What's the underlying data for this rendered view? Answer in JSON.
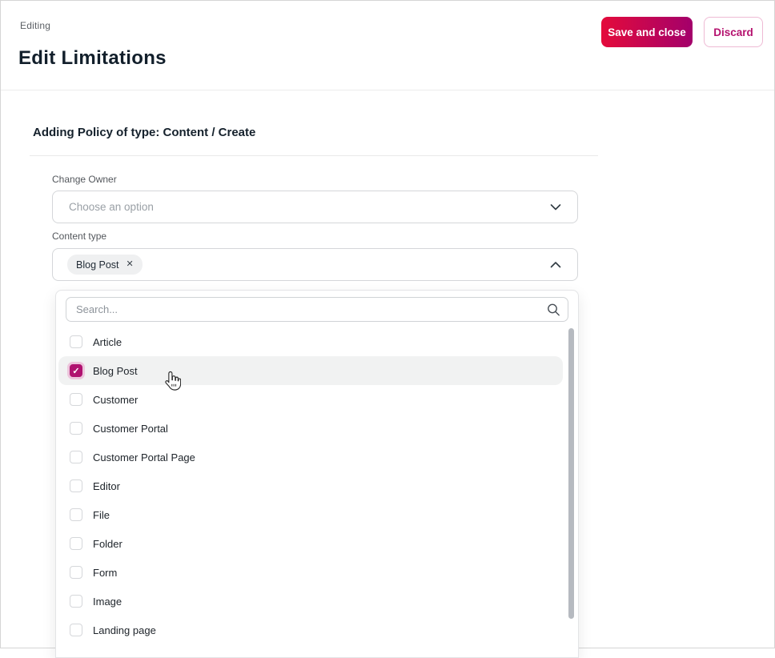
{
  "header": {
    "breadcrumb": "Editing",
    "title": "Edit Limitations",
    "save_label": "Save and close",
    "discard_label": "Discard"
  },
  "form": {
    "section_title": "Adding Policy of type: Content / Create",
    "change_owner": {
      "label": "Change Owner",
      "placeholder": "Choose an option"
    },
    "content_type": {
      "label": "Content type",
      "chip_label": "Blog Post",
      "chip_remove_glyph": "✕"
    }
  },
  "dropdown": {
    "search_placeholder": "Search...",
    "options": [
      {
        "label": "Article",
        "checked": false,
        "highlighted": false
      },
      {
        "label": "Blog Post",
        "checked": true,
        "highlighted": true
      },
      {
        "label": "Customer",
        "checked": false,
        "highlighted": false
      },
      {
        "label": "Customer Portal",
        "checked": false,
        "highlighted": false
      },
      {
        "label": "Customer Portal Page",
        "checked": false,
        "highlighted": false
      },
      {
        "label": "Editor",
        "checked": false,
        "highlighted": false
      },
      {
        "label": "File",
        "checked": false,
        "highlighted": false
      },
      {
        "label": "Folder",
        "checked": false,
        "highlighted": false
      },
      {
        "label": "Form",
        "checked": false,
        "highlighted": false
      },
      {
        "label": "Image",
        "checked": false,
        "highlighted": false
      },
      {
        "label": "Landing page",
        "checked": false,
        "highlighted": false
      }
    ]
  },
  "icons": {
    "chevron_down": "chevron-down",
    "chevron_up": "chevron-up",
    "search": "magnifier",
    "chip_close": "cross",
    "checked": "checkmark",
    "pointer": "hand-cursor"
  },
  "colors": {
    "accent_magenta": "#b01270",
    "save_gradient_start": "#e40b3b",
    "save_gradient_end": "#a3006b",
    "discard_border": "#eebad4",
    "row_highlight": "#f1f2f2",
    "text_dark": "#121f2b",
    "text_gray": "#53575c",
    "placeholder_gray": "#9aa0a6",
    "border_gray": "#d4d6d9",
    "scrollbar_thumb": "#b6bac0"
  }
}
